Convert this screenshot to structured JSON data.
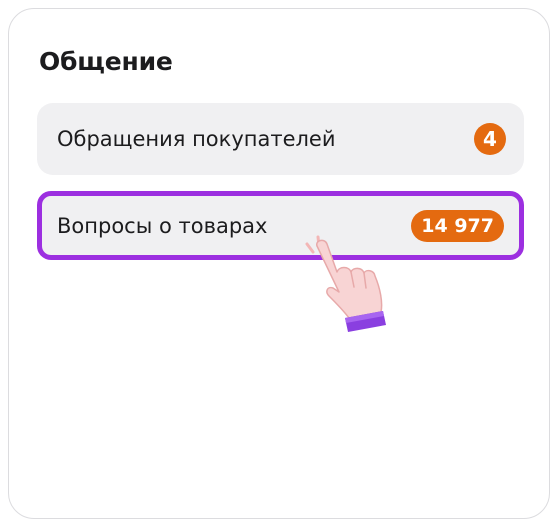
{
  "section": {
    "title": "Общение"
  },
  "items": [
    {
      "label": "Обращения покупателей",
      "count": "4"
    },
    {
      "label": "Вопросы о товарах",
      "count": "14 977"
    }
  ],
  "colors": {
    "badge": "#e46a10",
    "highlight": "#9c2fe0",
    "row_bg": "#f0f0f2"
  },
  "icons": {
    "pointer": "pointing-hand-icon"
  }
}
